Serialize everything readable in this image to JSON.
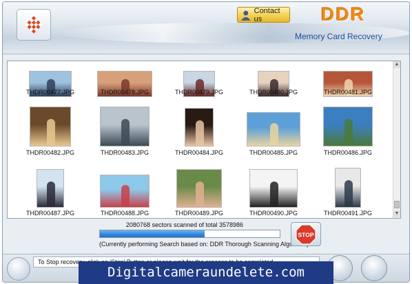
{
  "header": {
    "contact_label": "Contact us",
    "brand": "DDR",
    "subtitle": "Memory Card Recovery"
  },
  "files": [
    {
      "name": "THDR00477.JPG",
      "icon": "photo-skaters"
    },
    {
      "name": "THDR00478.JPG",
      "icon": "photo-group-indoor"
    },
    {
      "name": "THDR00479.JPG",
      "icon": "photo-people-standing"
    },
    {
      "name": "THDR00480.JPG",
      "icon": "photo-seated-person"
    },
    {
      "name": "THDR00481.JPG",
      "icon": "photo-crowd"
    },
    {
      "name": "THDR00482.JPG",
      "icon": "photo-two-people"
    },
    {
      "name": "THDR00483.JPG",
      "icon": "photo-office"
    },
    {
      "name": "THDR00484.JPG",
      "icon": "photo-portrait-woman"
    },
    {
      "name": "THDR00485.JPG",
      "icon": "photo-beach"
    },
    {
      "name": "THDR00486.JPG",
      "icon": "photo-islands"
    },
    {
      "name": "THDR00487.JPG",
      "icon": "photo-woman-smiling"
    },
    {
      "name": "THDR00488.JPG",
      "icon": "photo-umbrella-beach"
    },
    {
      "name": "THDR00489.JPG",
      "icon": "photo-friends"
    },
    {
      "name": "THDR00490.JPG",
      "icon": "photo-woman-laptop"
    },
    {
      "name": "THDR00491.JPG",
      "icon": "photo-woman-standing"
    }
  ],
  "scan": {
    "sectors_text": "2080768 sectors scanned of total 3578986",
    "progress": 0.5814,
    "algorithm_text": "(Currently performing Search based on:  DDR Thorough Scanning Algorithm)"
  },
  "stop_label": "STOP",
  "status": {
    "message": "To Stop recovery, click on 'Stop' Button or please wait for the process to be completed."
  },
  "banner": "Digitalcameraundelete.com",
  "colors": {
    "brand_orange": "#f08a1a",
    "subtitle_blue": "#1f4f99",
    "banner_bg": "#1f3b86",
    "stop_red": "#d83a2c"
  }
}
